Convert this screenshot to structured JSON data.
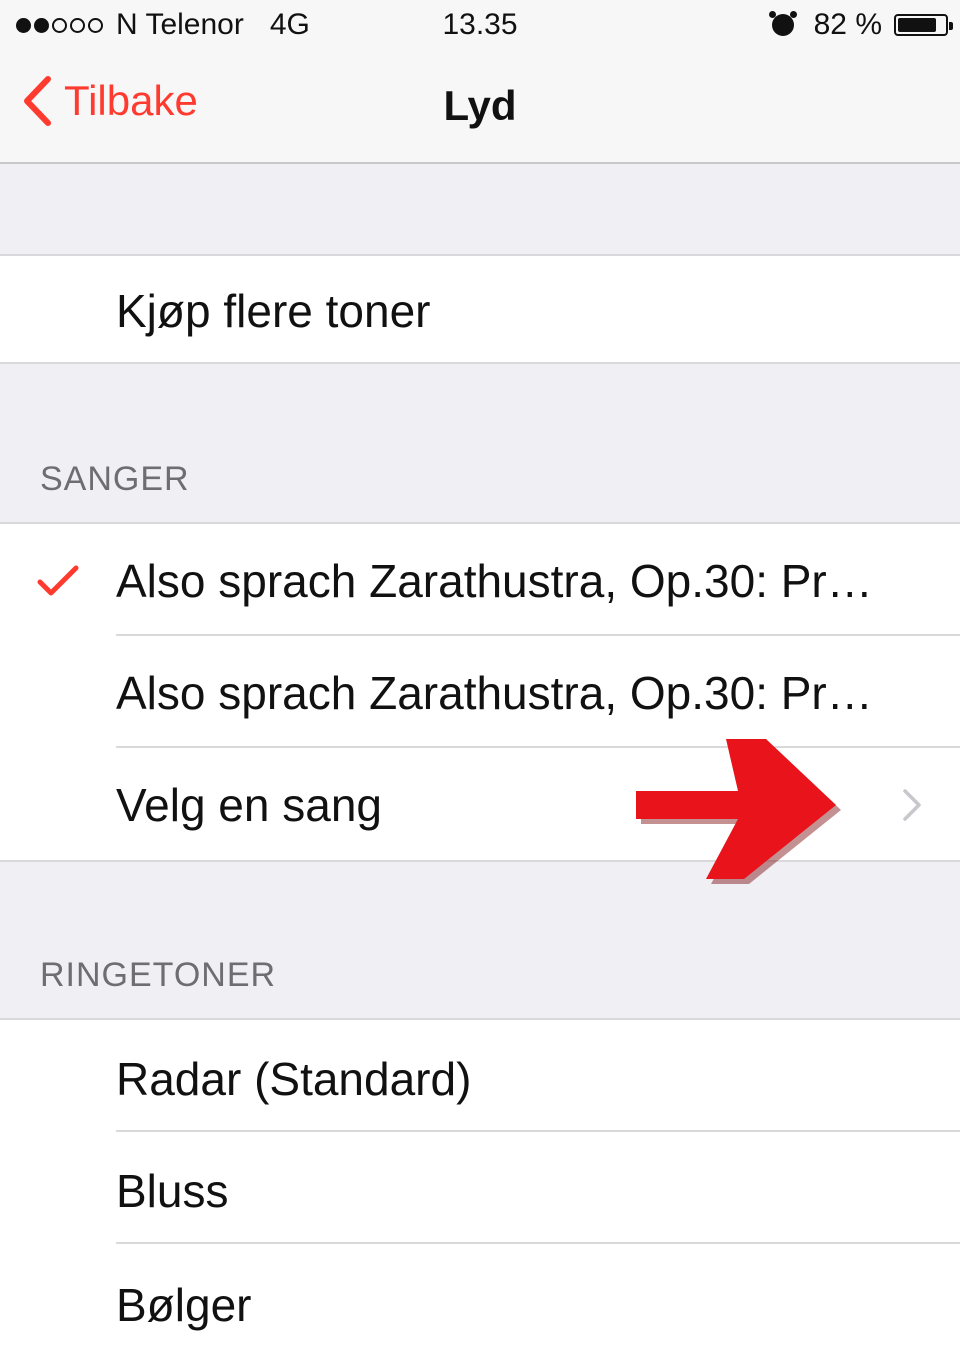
{
  "status_bar": {
    "signal_bars_filled": 2,
    "signal_bars_total": 5,
    "carrier": "N Telenor",
    "network": "4G",
    "time": "13.35",
    "battery_percent": "82 %",
    "battery_level": 0.82,
    "alarm_icon": "alarm-clock-icon"
  },
  "nav": {
    "back_label": "Tilbake",
    "title": "Lyd",
    "accent_color": "#ff3b30"
  },
  "store": {
    "label": "Kjøp flere toner"
  },
  "songs": {
    "header": "SANGER",
    "items": [
      {
        "label": "Also sprach Zarathustra, Op.30: Pr…",
        "selected": true
      },
      {
        "label": "Also sprach Zarathustra, Op.30: Pr…",
        "selected": false
      }
    ],
    "pick_label": "Velg en sang"
  },
  "ringtones": {
    "header": "RINGETONER",
    "items": [
      {
        "label": "Radar (Standard)"
      },
      {
        "label": "Bluss"
      },
      {
        "label": "Bølger"
      }
    ]
  },
  "annotation": {
    "arrow_color": "#e8131b"
  }
}
